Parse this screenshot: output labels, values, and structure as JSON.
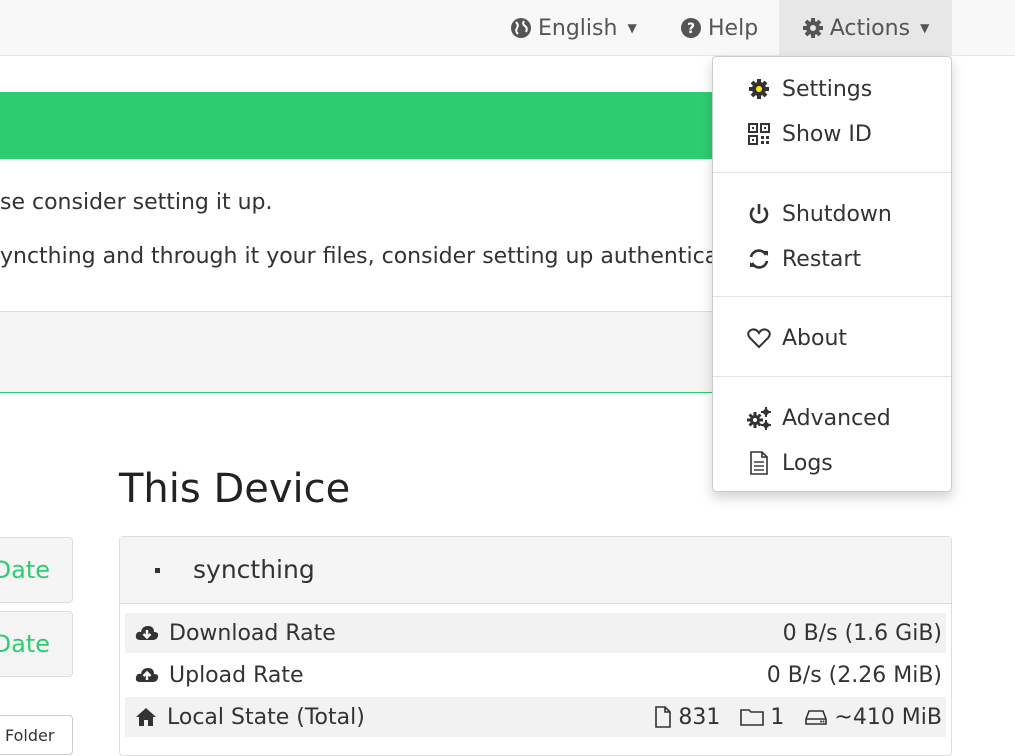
{
  "navbar": {
    "language": "English",
    "help": "Help",
    "actions": "Actions"
  },
  "alert": {
    "line1": "se consider setting it up.",
    "line2": "yncthing and through it your files, consider setting up authenticatio"
  },
  "side_buttons": {
    "btn1": "Date",
    "btn2": "Date",
    "btn3": "Folder"
  },
  "device": {
    "section_title": "This Device",
    "name": "syncthing",
    "rows": [
      {
        "label": "Download Rate",
        "value": "0 B/s (1.6 GiB)"
      },
      {
        "label": "Upload Rate",
        "value": "0 B/s (2.26 MiB)"
      },
      {
        "label": "Local State (Total)",
        "files": "831",
        "folders": "1",
        "size": "~410 MiB"
      }
    ]
  },
  "actions_menu": {
    "items": [
      {
        "label": "Settings",
        "icon": "gear-icon"
      },
      {
        "label": "Show ID",
        "icon": "qrcode-icon"
      },
      {
        "label": "Shutdown",
        "icon": "power-icon"
      },
      {
        "label": "Restart",
        "icon": "refresh-icon"
      },
      {
        "label": "About",
        "icon": "heart-icon"
      },
      {
        "label": "Advanced",
        "icon": "cogs-icon"
      },
      {
        "label": "Logs",
        "icon": "document-icon"
      }
    ],
    "highlight_color": "#fff200"
  },
  "colors": {
    "accent_green": "#2ecc71",
    "navbar_bg": "#f8f8f8"
  }
}
